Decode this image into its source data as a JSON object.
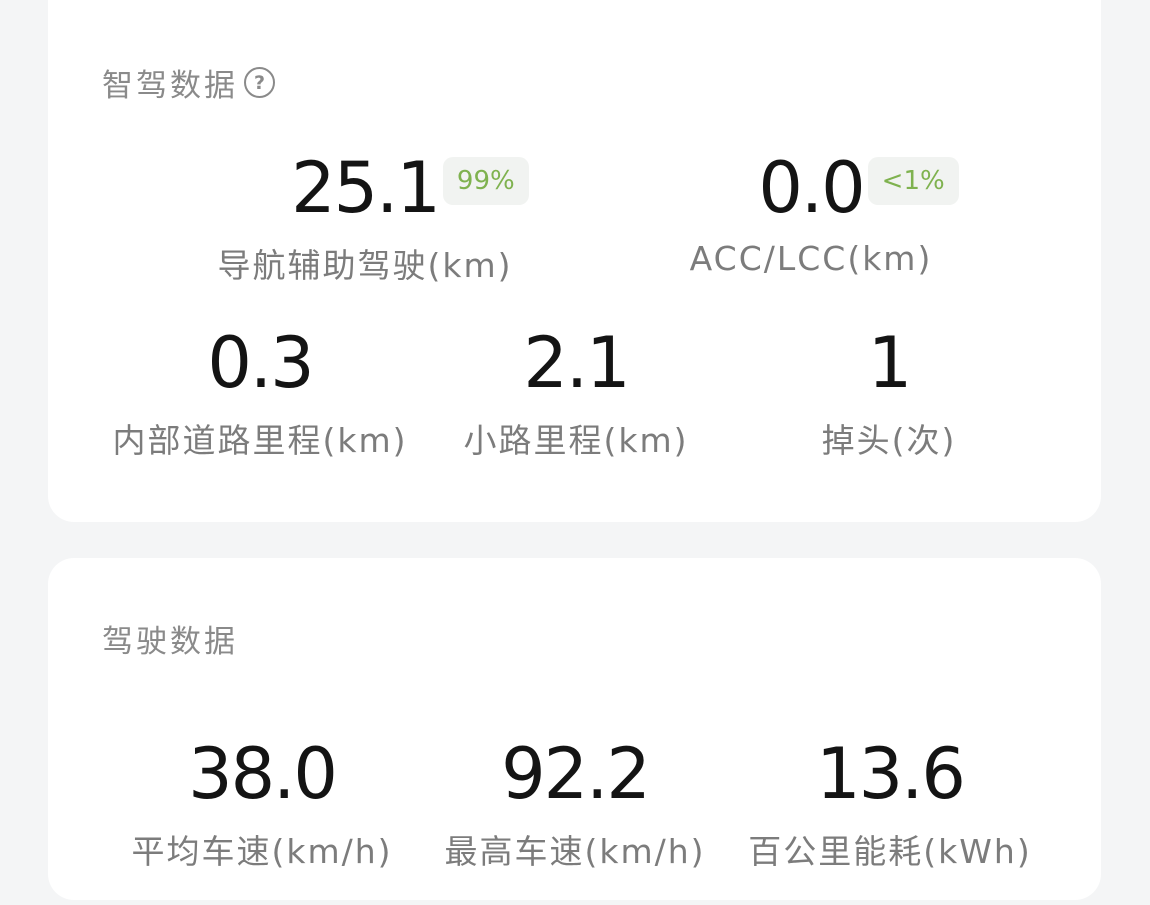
{
  "assist": {
    "title": "智驾数据",
    "help_glyph": "?",
    "metrics": [
      {
        "value": "25.1",
        "badge": "99%",
        "label": "导航辅助驾驶(km)"
      },
      {
        "value": "0.0",
        "badge": "<1%",
        "label": "ACC/LCC(km)"
      },
      {
        "value": "0.3",
        "label": "内部道路里程(km)"
      },
      {
        "value": "2.1",
        "label": "小路里程(km)"
      },
      {
        "value": "1",
        "label": "掉头(次)"
      }
    ]
  },
  "drive": {
    "title": "驾驶数据",
    "metrics": [
      {
        "value": "38.0",
        "label": "平均车速(km/h)"
      },
      {
        "value": "92.2",
        "label": "最高车速(km/h)"
      },
      {
        "value": "13.6",
        "label": "百公里能耗(kWh)"
      }
    ]
  },
  "colors": {
    "badge_text": "#7fb24f",
    "badge_bg": "#f1f3f1",
    "card_bg": "#ffffff",
    "page_bg": "#f4f5f6"
  }
}
